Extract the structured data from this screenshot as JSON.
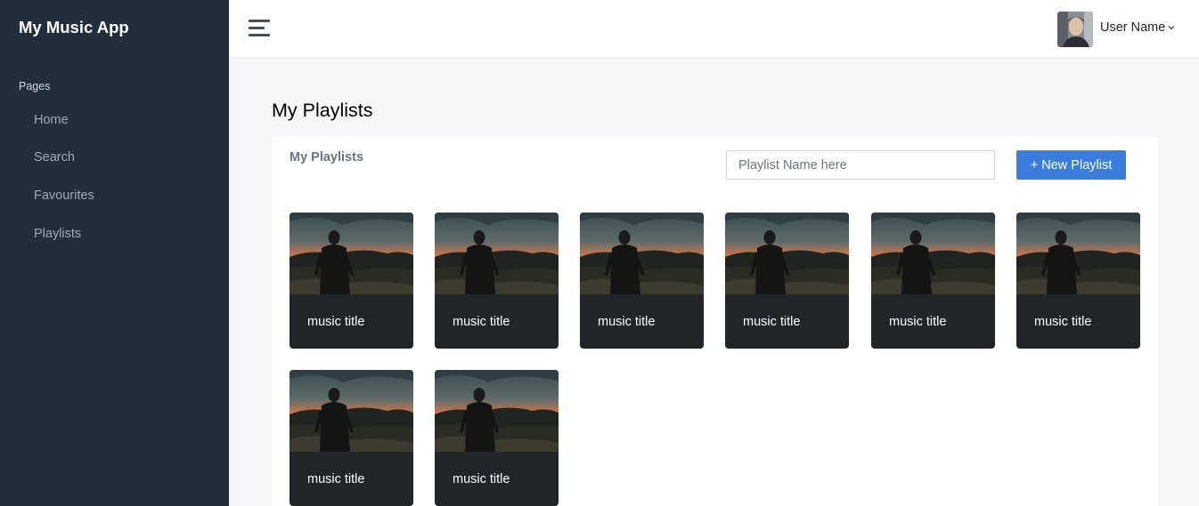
{
  "app": {
    "brand": "My Music App"
  },
  "sidebar": {
    "section_header": "Pages",
    "items": [
      {
        "label": "Home"
      },
      {
        "label": "Search"
      },
      {
        "label": "Favourites"
      },
      {
        "label": "Playlists"
      }
    ]
  },
  "navbar": {
    "menu_icon": "hamburger-icon",
    "user_name": "User Name",
    "user_menu_icon": "chevron-down-icon"
  },
  "page": {
    "title": "My Playlists"
  },
  "card": {
    "title": "My Playlists",
    "search": {
      "placeholder": "Playlist Name here",
      "value": ""
    },
    "new_button_label": "+ New Playlist"
  },
  "playlists": [
    {
      "title": "music title"
    },
    {
      "title": "music title"
    },
    {
      "title": "music title"
    },
    {
      "title": "music title"
    },
    {
      "title": "music title"
    },
    {
      "title": "music title"
    },
    {
      "title": "music title"
    },
    {
      "title": "music title"
    }
  ],
  "colors": {
    "sidebar_bg": "#222e3c",
    "primary": "#3b7ddd",
    "tile_bg": "#212529",
    "page_bg": "#f5f6f8"
  }
}
